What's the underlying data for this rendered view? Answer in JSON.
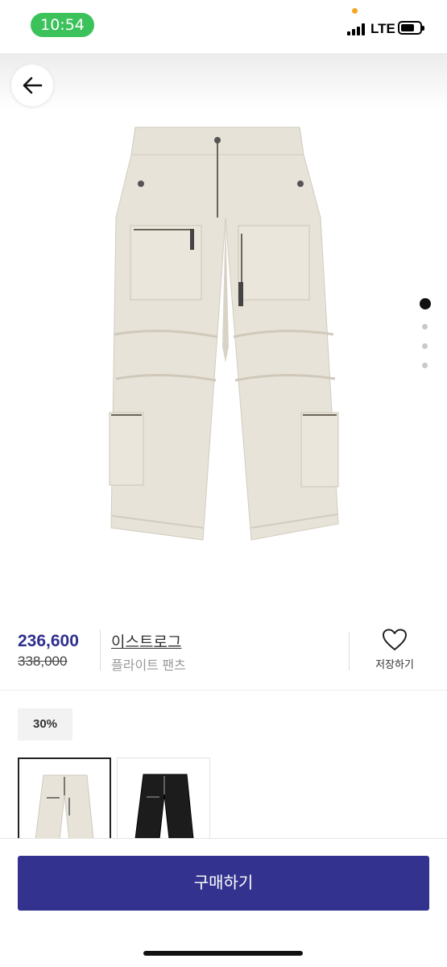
{
  "status_bar": {
    "time": "10:54",
    "network": "LTE"
  },
  "hero": {
    "image_count": 4,
    "active_index": 0
  },
  "product": {
    "price": "236,600",
    "original_price": "338,000",
    "brand": "이스트로그",
    "name": "플라이트 팬츠",
    "save_label": "저장하기",
    "discount": "30%"
  },
  "variants": [
    {
      "color": "ivory"
    },
    {
      "color": "black"
    }
  ],
  "actions": {
    "buy_label": "구매하기"
  },
  "colors": {
    "accent": "#33338f",
    "price": "#2e2f8f",
    "time_pill": "#3cc25b"
  }
}
